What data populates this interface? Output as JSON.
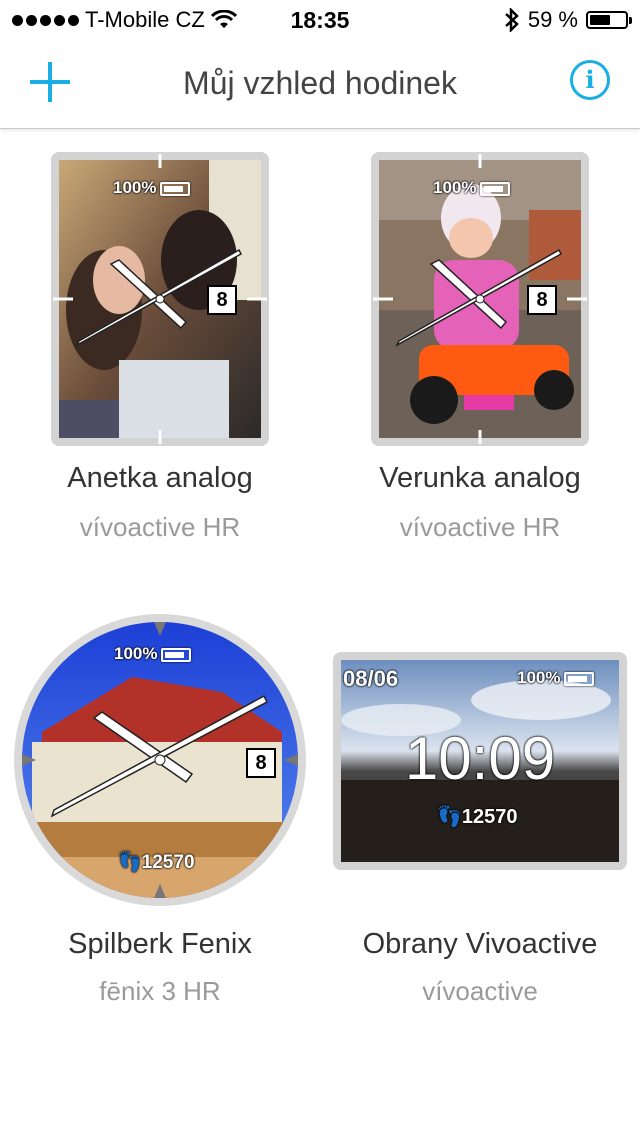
{
  "status_bar": {
    "carrier": "T-Mobile CZ",
    "time": "18:35",
    "battery_percent": "59 %",
    "battery_level": 0.59,
    "icons": [
      "signal-dots-icon",
      "wifi-icon",
      "bluetooth-icon",
      "battery-icon"
    ]
  },
  "nav": {
    "title": "Můj vzhled hodinek",
    "add_icon": "plus-icon",
    "info_icon": "info-icon",
    "accent_color": "#1aaee6"
  },
  "watchfaces": [
    {
      "name": "Anetka analog",
      "device": "vívoactive HR",
      "shape": "rect",
      "battery_text": "100%",
      "date_text": "8"
    },
    {
      "name": "Verunka analog",
      "device": "vívoactive HR",
      "shape": "rect",
      "battery_text": "100%",
      "date_text": "8"
    },
    {
      "name": "Spilberk Fenix",
      "device": "fēnix 3 HR",
      "shape": "round",
      "battery_text": "100%",
      "date_text": "8",
      "steps_text": "12570"
    },
    {
      "name": "Obrany Vivoactive",
      "device": "vívoactive",
      "shape": "rect-wide",
      "battery_text": "100%",
      "date_text": "08/06",
      "time_text": "10:09",
      "steps_text": "12570"
    }
  ]
}
